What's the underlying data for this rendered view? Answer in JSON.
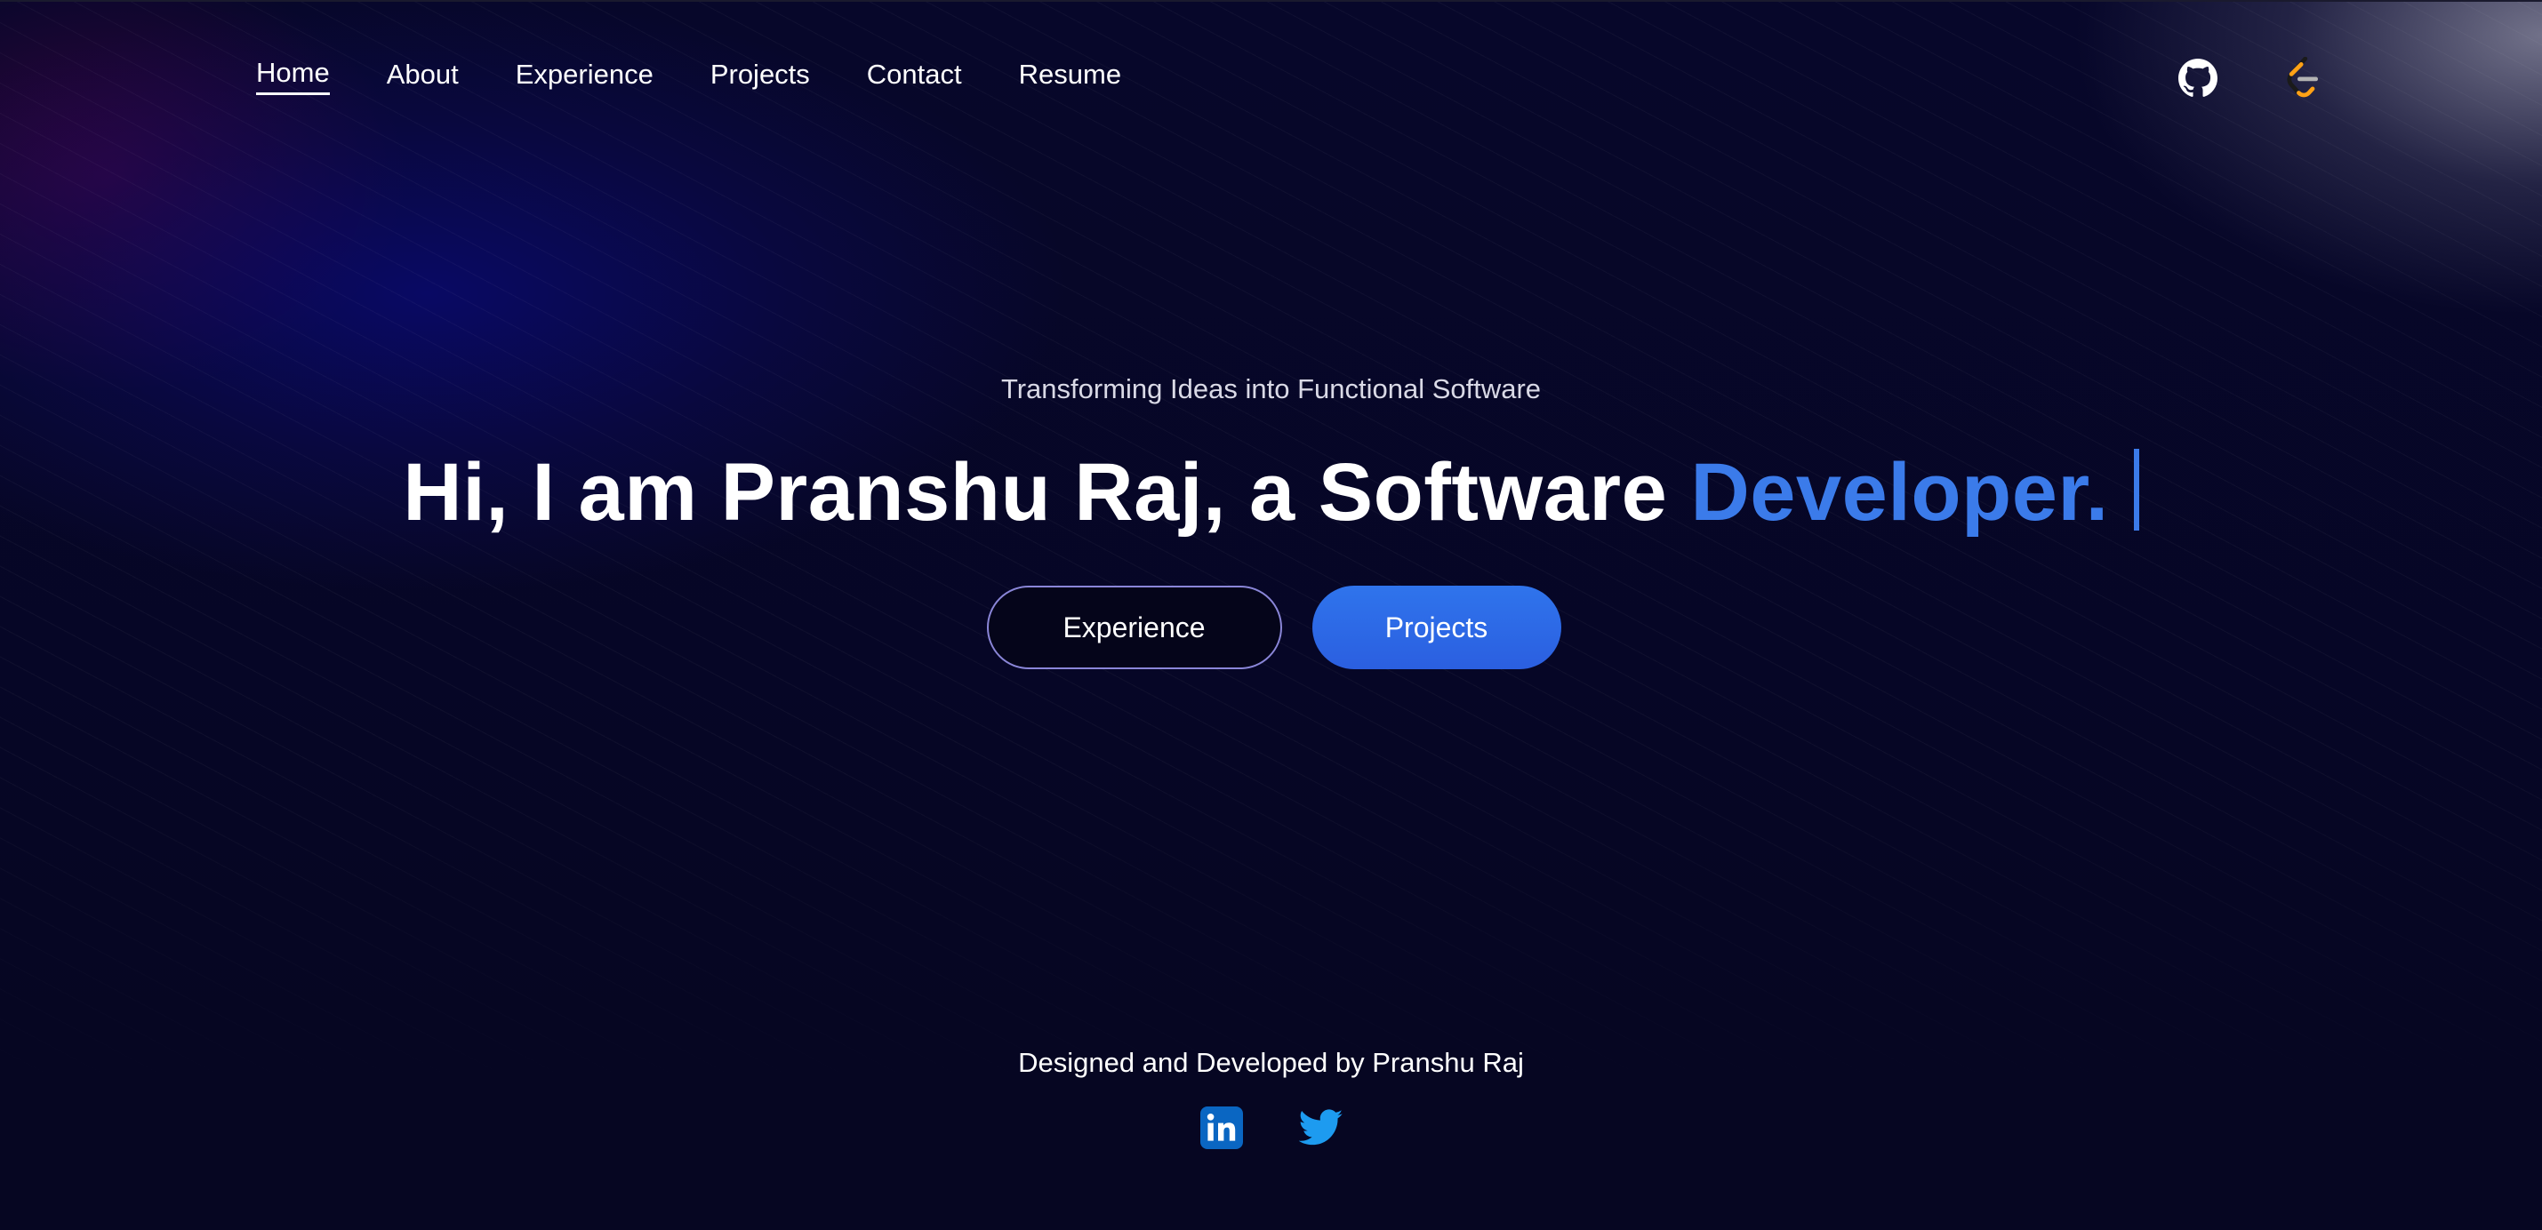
{
  "nav": {
    "links": [
      {
        "label": "Home",
        "active": true
      },
      {
        "label": "About"
      },
      {
        "label": "Experience"
      },
      {
        "label": "Projects"
      },
      {
        "label": "Contact"
      },
      {
        "label": "Resume"
      }
    ],
    "icons": [
      "github-icon",
      "leetcode-icon"
    ]
  },
  "hero": {
    "tagline": "Transforming Ideas into Functional Software",
    "headline_prefix": "Hi, I am Pranshu Raj, a Software ",
    "headline_accent": "Developer.",
    "buttons": {
      "primary_outline": "Experience",
      "primary_fill": "Projects"
    }
  },
  "footer": {
    "credit": "Designed and Developed by Pranshu Raj",
    "social_icons": [
      "linkedin-icon",
      "twitter-icon"
    ]
  },
  "colors": {
    "background": "#060622",
    "accent": "#3b7bea",
    "button_fill": "#2f74ec",
    "button_outline_border": "#8a86d8",
    "linkedin": "#0a66c2",
    "twitter": "#1d9bf0"
  }
}
